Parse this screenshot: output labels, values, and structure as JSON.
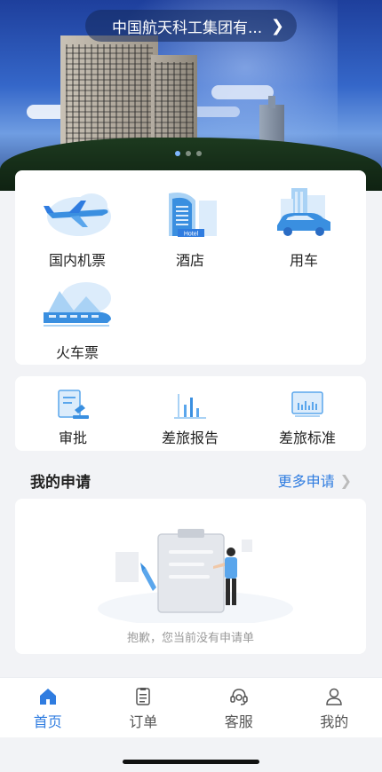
{
  "banner": {
    "company_name": "中国航天科工集团有...",
    "chevron": "chevron-right-icon",
    "dots_count": 3,
    "active_dot": 0
  },
  "services": [
    {
      "label": "国内机票",
      "icon": "plane-icon"
    },
    {
      "label": "酒店",
      "icon": "hotel-icon",
      "icon_text": "Hotel"
    },
    {
      "label": "用车",
      "icon": "car-icon"
    },
    {
      "label": "火车票",
      "icon": "train-icon"
    }
  ],
  "tools": [
    {
      "label": "审批",
      "icon": "approval-icon"
    },
    {
      "label": "差旅报告",
      "icon": "bar-chart-icon"
    },
    {
      "label": "差旅标准",
      "icon": "standard-monitor-icon"
    }
  ],
  "my_applications": {
    "title": "我的申请",
    "more_label": "更多申请",
    "empty_text": "抱歉，您当前没有申请单"
  },
  "tabbar": [
    {
      "label": "首页",
      "icon": "home-icon",
      "active": true
    },
    {
      "label": "订单",
      "icon": "order-icon",
      "active": false
    },
    {
      "label": "客服",
      "icon": "headset-icon",
      "active": false
    },
    {
      "label": "我的",
      "icon": "user-icon",
      "active": false
    }
  ],
  "colors": {
    "accent": "#2f7ce0",
    "icon_light": "#a9d2f5",
    "icon_dark": "#3a8fe0",
    "background": "#f2f3f6"
  }
}
